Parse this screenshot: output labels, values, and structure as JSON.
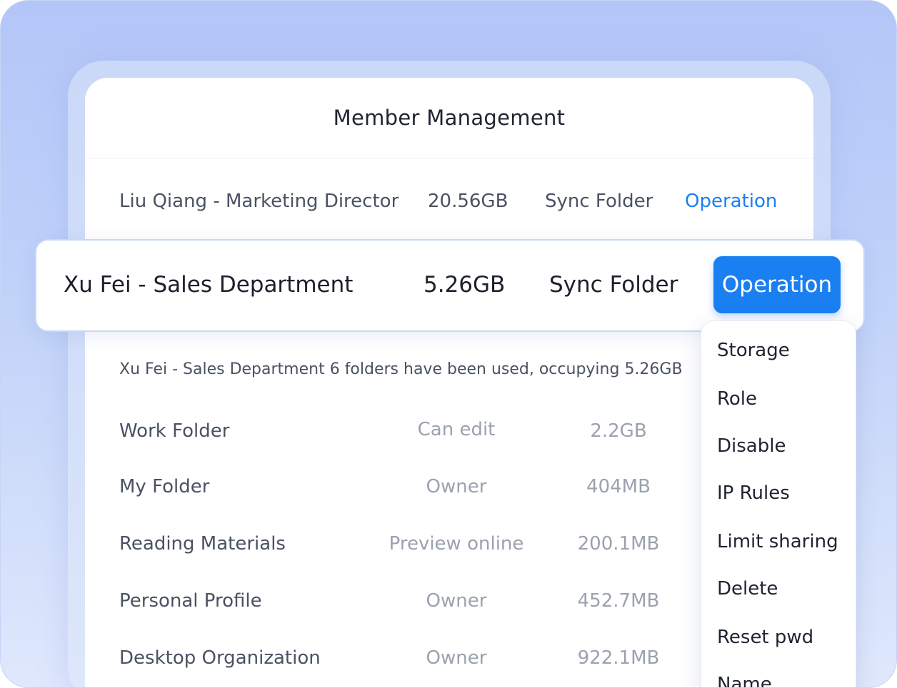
{
  "title": "Member Management",
  "members": [
    {
      "name": "Liu Qiang - Marketing Director",
      "size": "20.56GB",
      "type": "Sync Folder",
      "action": "Operation"
    },
    {
      "name": "Xu Fei - Sales Department",
      "size": "5.26GB",
      "type": "Sync Folder",
      "action": "Operation"
    }
  ],
  "summary": "Xu Fei - Sales Department 6 folders have been used, occupying 5.26GB",
  "folders": [
    {
      "name": "Work Folder",
      "permission": "Can edit",
      "size": "2.2GB"
    },
    {
      "name": "My Folder",
      "permission": "Owner",
      "size": "404MB"
    },
    {
      "name": "Reading Materials",
      "permission": "Preview online",
      "size": "200.1MB"
    },
    {
      "name": "Personal Profile",
      "permission": "Owner",
      "size": "452.7MB"
    },
    {
      "name": "Desktop Organization",
      "permission": "Owner",
      "size": "922.1MB"
    }
  ],
  "menu": {
    "items": [
      "Storage",
      "Role",
      "Disable",
      "IP Rules",
      "Limit sharing",
      "Delete",
      "Reset pwd",
      "Name"
    ]
  },
  "colors": {
    "accent": "#1a7ff0",
    "background": "#b3c6f8",
    "text_primary": "#1f2430",
    "text_secondary": "#4a5262",
    "text_muted": "#9ba2ae"
  }
}
